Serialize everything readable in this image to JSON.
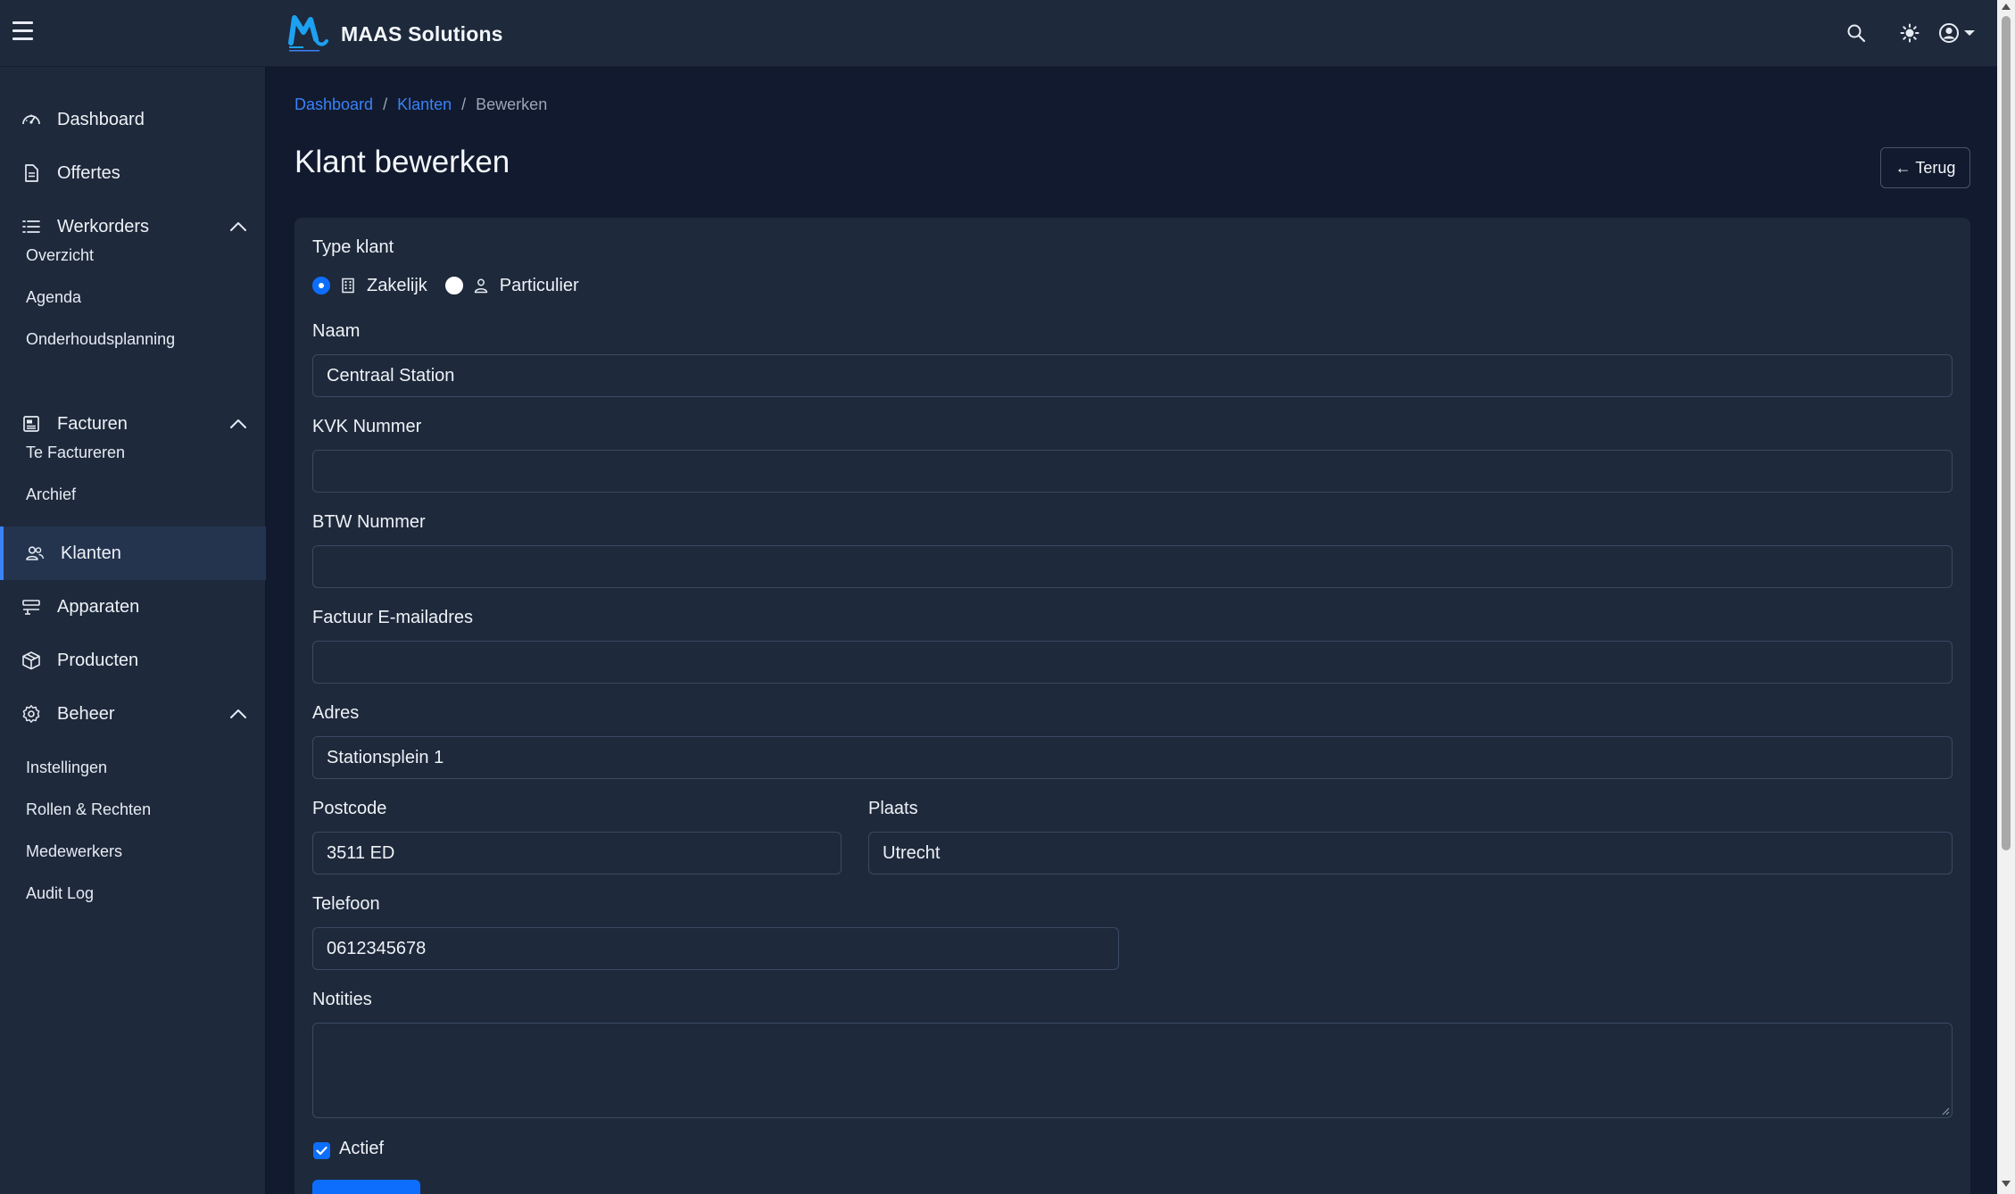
{
  "app": {
    "brand_name": "MAAS Solutions",
    "accent_color": "#3b82f6"
  },
  "topbar": {
    "icons": [
      "menu-icon",
      "search-icon",
      "theme-toggle-icon",
      "user-account-icon",
      "caret-down-icon"
    ]
  },
  "sidebar": {
    "items": [
      {
        "label": "Dashboard",
        "icon": "dashboard-gauge-icon"
      },
      {
        "label": "Offertes",
        "icon": "document-icon"
      },
      {
        "label": "Werkorders",
        "icon": "list-icon",
        "expanded": true,
        "children": [
          "Overzicht",
          "Agenda",
          "Onderhoudsplanning"
        ]
      },
      {
        "label": "Facturen",
        "icon": "invoice-icon",
        "expanded": true,
        "children": [
          "Te Factureren",
          "Archief"
        ]
      },
      {
        "label": "Klanten",
        "icon": "users-icon",
        "active": true
      },
      {
        "label": "Apparaten",
        "icon": "devices-icon"
      },
      {
        "label": "Producten",
        "icon": "box-icon"
      },
      {
        "label": "Beheer",
        "icon": "gear-icon",
        "expanded": true,
        "children": [
          "Instellingen",
          "Rollen & Rechten",
          "Medewerkers",
          "Audit Log"
        ]
      }
    ]
  },
  "breadcrumb": {
    "items": [
      "Dashboard",
      "Klanten"
    ],
    "separator": "/",
    "current": "Bewerken"
  },
  "page": {
    "title": "Klant bewerken",
    "back_label": "← Terug"
  },
  "form": {
    "type_label": "Type klant",
    "type_options": [
      {
        "label": "Zakelijk",
        "selected": true,
        "icon": "building-icon"
      },
      {
        "label": "Particulier",
        "selected": false,
        "icon": "person-icon"
      }
    ],
    "naam": {
      "label": "Naam",
      "value": "Centraal Station"
    },
    "kvk": {
      "label": "KVK Nummer",
      "value": ""
    },
    "btw": {
      "label": "BTW Nummer",
      "value": ""
    },
    "factuur_email": {
      "label": "Factuur E-mailadres",
      "value": ""
    },
    "adres": {
      "label": "Adres",
      "value": "Stationsplein 1"
    },
    "postcode": {
      "label": "Postcode",
      "value": "3511 ED"
    },
    "plaats": {
      "label": "Plaats",
      "value": "Utrecht"
    },
    "telefoon": {
      "label": "Telefoon",
      "value": "0612345678"
    },
    "notities": {
      "label": "Notities",
      "value": ""
    },
    "actief": {
      "label": "Actief",
      "checked": true
    }
  }
}
